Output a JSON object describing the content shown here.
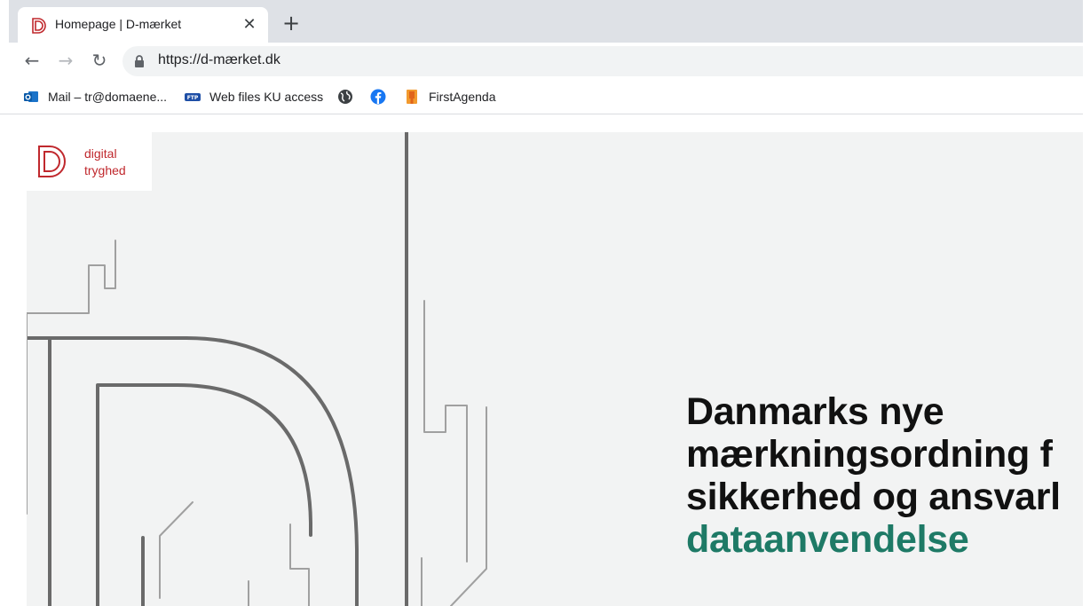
{
  "browser": {
    "tab": {
      "title": "Homepage | D-mærket",
      "close_icon": "close-icon"
    },
    "new_tab_icon": "plus-icon",
    "toolbar": {
      "back_icon": "arrow-left-icon",
      "forward_icon": "arrow-right-icon",
      "reload_icon": "reload-icon",
      "url": "https://d-mærket.dk",
      "lock_icon": "lock-icon"
    },
    "bookmarks": [
      {
        "label": "Mail – tr@domaene...",
        "icon": "outlook-icon"
      },
      {
        "label": "Web files KU access",
        "icon": "ftp-icon"
      },
      {
        "label": "",
        "icon": "globe-icon"
      },
      {
        "label": "",
        "icon": "facebook-icon"
      },
      {
        "label": "FirstAgenda",
        "icon": "firstagenda-icon"
      }
    ]
  },
  "site": {
    "logo": {
      "line1": "digital",
      "line2": "tryghed"
    },
    "hero": {
      "line1": "Danmarks nye",
      "line2": "mærkningsordning f",
      "line3": "sikkerhed og ansvarl",
      "line4": "dataanvendelse"
    },
    "colors": {
      "brand_red": "#c0282d",
      "accent_green": "#1e7a66",
      "background": "#f2f3f3"
    }
  }
}
